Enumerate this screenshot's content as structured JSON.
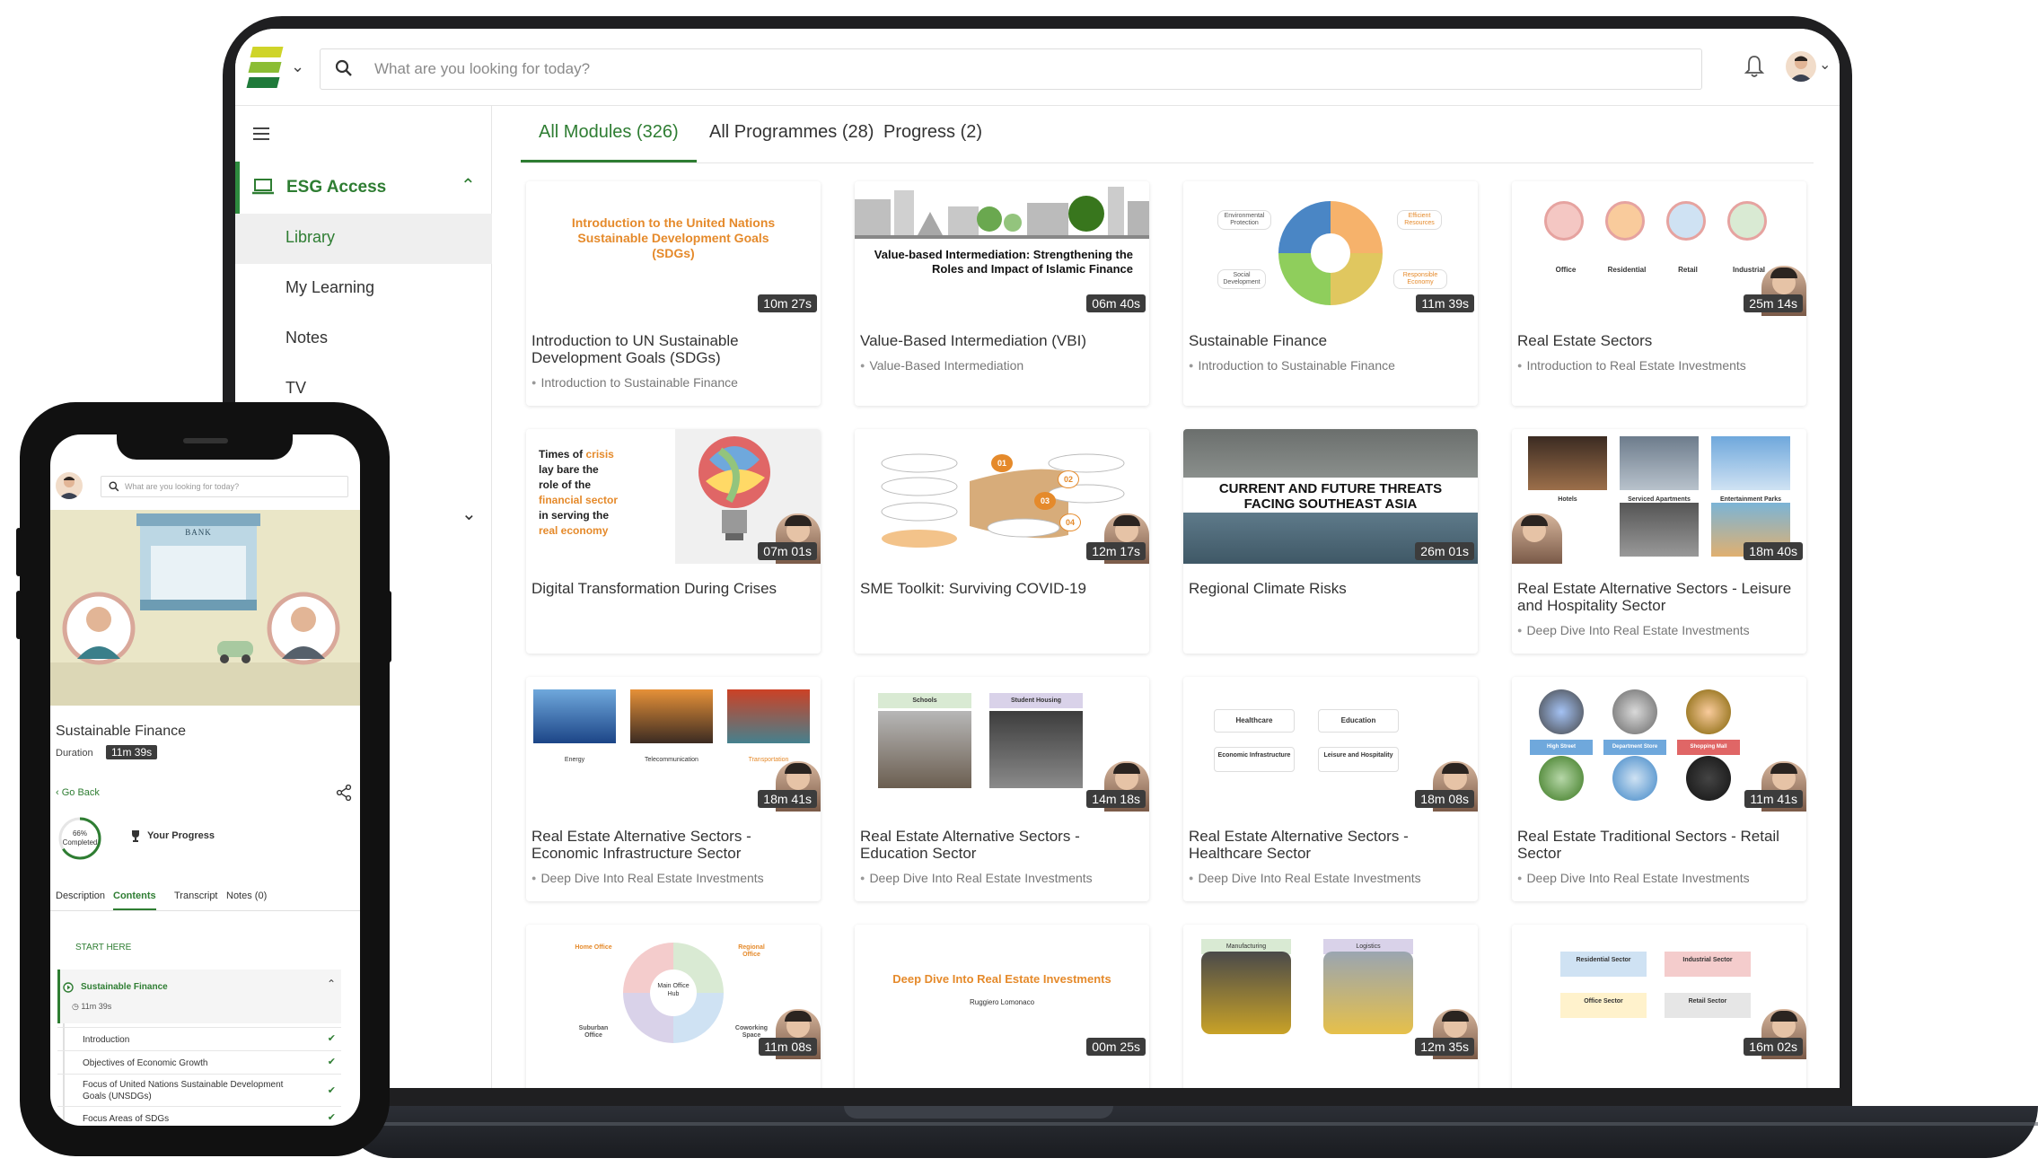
{
  "search": {
    "placeholder": "What are you looking for today?"
  },
  "sidebar": {
    "section_label": "ESG Access",
    "items": [
      {
        "label": "Library",
        "active": true
      },
      {
        "label": "My Learning",
        "active": false
      },
      {
        "label": "Notes",
        "active": false
      },
      {
        "label": "TV",
        "active": false
      }
    ]
  },
  "tabs": [
    {
      "label": "All Modules (326)",
      "active": true
    },
    {
      "label": "All Programmes (28)",
      "active": false
    },
    {
      "label": "Progress (2)",
      "active": false
    }
  ],
  "cards": [
    {
      "title": "Introduction to UN Sustainable Development Goals (SDGs)",
      "subtitle": "Introduction to Sustainable Finance",
      "duration": "10m 27s",
      "thumb_text": "Introduction to the United Nations Sustainable Development Goals (SDGs)"
    },
    {
      "title": "Value-Based Intermediation (VBI)",
      "subtitle": "Value-Based Intermediation",
      "duration": "06m 40s",
      "thumb_text": "Value-based Intermediation: Strengthening the Roles and Impact of Islamic Finance"
    },
    {
      "title": "Sustainable Finance",
      "subtitle": "Introduction to Sustainable Finance",
      "duration": "11m 39s",
      "thumb_labels": [
        "Environmental Protection",
        "Efficient Resources",
        "Social Development",
        "Responsible Economy"
      ]
    },
    {
      "title": "Real Estate Sectors",
      "subtitle": "Introduction to Real Estate Investments",
      "duration": "25m 14s",
      "thumb_labels": [
        "Office",
        "Residential",
        "Retail",
        "Industrial"
      ]
    },
    {
      "title": "Digital Transformation During Crises",
      "subtitle": "",
      "duration": "07m 01s",
      "thumb_lines": [
        "Times of ",
        "crisis",
        "lay bare the",
        "role of the",
        "financial sector",
        "in serving the",
        "real economy"
      ]
    },
    {
      "title": "SME Toolkit: Surviving COVID-19",
      "subtitle": "",
      "duration": "12m 17s",
      "thumb_labels": [
        "01",
        "02",
        "03",
        "04"
      ]
    },
    {
      "title": "Regional Climate Risks",
      "subtitle": "",
      "duration": "26m 01s",
      "thumb_text": "CURRENT AND FUTURE THREATS FACING SOUTHEAST ASIA"
    },
    {
      "title": "Real Estate Alternative Sectors - Leisure and Hospitality Sector",
      "subtitle": "Deep Dive Into Real Estate Investments",
      "duration": "18m 40s",
      "thumb_labels": [
        "Hotels",
        "Serviced Apartments",
        "Entertainment Parks"
      ]
    },
    {
      "title": "Real Estate Alternative Sectors - Economic Infrastructure Sector",
      "subtitle": "Deep Dive Into Real Estate Investments",
      "duration": "18m 41s",
      "thumb_labels": [
        "Energy",
        "Telecommunication",
        "Transportation"
      ]
    },
    {
      "title": "Real Estate Alternative Sectors - Education Sector",
      "subtitle": "Deep Dive Into Real Estate Investments",
      "duration": "14m 18s",
      "thumb_labels": [
        "Schools",
        "Student Housing"
      ]
    },
    {
      "title": "Real Estate Alternative Sectors - Healthcare Sector",
      "subtitle": "Deep Dive Into Real Estate Investments",
      "duration": "18m 08s",
      "thumb_labels": [
        "Healthcare",
        "Education",
        "Economic Infrastructure",
        "Leisure and Hospitality"
      ]
    },
    {
      "title": "Real Estate Traditional Sectors - Retail Sector",
      "subtitle": "Deep Dive Into Real Estate Investments",
      "duration": "11m 41s",
      "thumb_labels": [
        "High Street",
        "Department Store",
        "Shopping Mall"
      ]
    },
    {
      "title": "",
      "subtitle": "",
      "duration": "11m 08s",
      "thumb_labels": [
        "Home Office",
        "Regional Office",
        "Main Office Hub",
        "Suburban Office",
        "Coworking Space"
      ]
    },
    {
      "title": "",
      "subtitle": "",
      "duration": "00m 25s",
      "thumb_text": "Deep Dive Into Real Estate Investments",
      "thumb_subtext": "Ruggiero Lomonaco"
    },
    {
      "title": "",
      "subtitle": "",
      "duration": "12m 35s",
      "thumb_labels": [
        "Manufacturing",
        "Logistics"
      ]
    },
    {
      "title": "",
      "subtitle": "",
      "duration": "16m 02s",
      "thumb_labels": [
        "Residential Sector",
        "Industrial Sector",
        "Office Sector",
        "Retail Sector"
      ]
    }
  ],
  "phone": {
    "search_placeholder": "What are you looking for today?",
    "hero_sign": "BANK",
    "course_title": "Sustainable Finance",
    "duration_label": "Duration",
    "duration_value": "11m 39s",
    "go_back": "Go Back",
    "progress_pct": "66%",
    "progress_word": "Completed",
    "progress_label": "Your Progress",
    "tabs": [
      "Description",
      "Contents",
      "Transcript",
      "Notes (0)"
    ],
    "active_tab": "Contents",
    "start_here": "START HERE",
    "section_title": "Sustainable Finance",
    "section_duration": "11m 39s",
    "lessons": [
      "Introduction",
      "Objectives of Economic Growth",
      "Focus of United Nations Sustainable Development Goals (UNSDGs)",
      "Focus Areas of SDGs"
    ]
  },
  "colors": {
    "brand_green": "#2e7d32",
    "accent_orange": "#e58a2b",
    "duration_badge": "#3c3c3c"
  },
  "icons": [
    "logo",
    "chevron-down-icon",
    "search-icon",
    "bell-icon",
    "avatar",
    "hamburger-icon",
    "laptop-icon",
    "chevron-up-icon",
    "share-icon",
    "trophy-icon",
    "play-icon",
    "check-icon"
  ]
}
